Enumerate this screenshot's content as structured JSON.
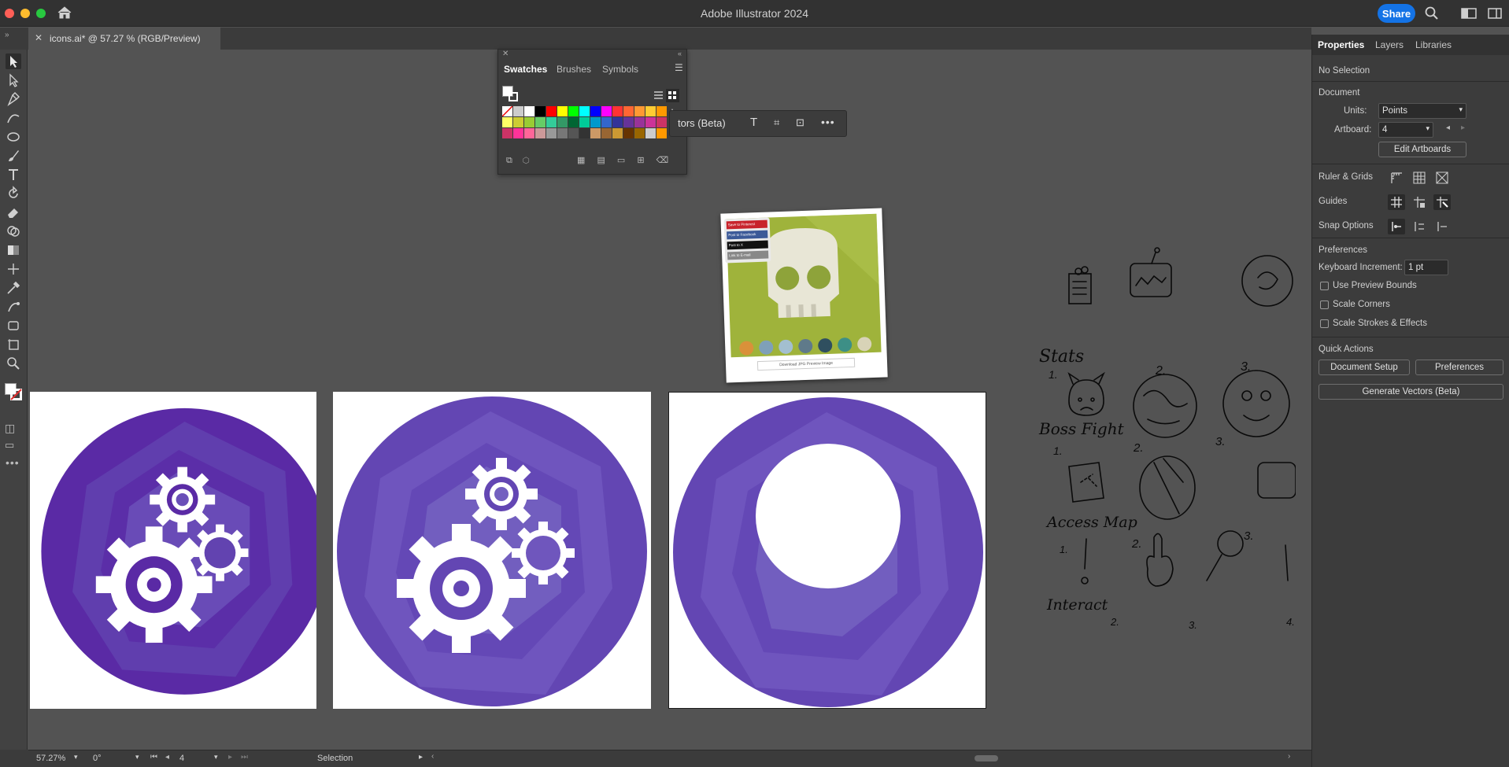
{
  "app": {
    "title": "Adobe Illustrator 2024",
    "share_label": "Share"
  },
  "document_tab": {
    "title": "icons.ai* @ 57.27 % (RGB/Preview)"
  },
  "swatches_panel": {
    "tabs": [
      "Swatches",
      "Brushes",
      "Symbols"
    ]
  },
  "context_bar": {
    "label": "tors (Beta)"
  },
  "preview_card": {
    "badges": [
      "Save to Pinterest",
      "Post to Facebook",
      "Post to X",
      "Link to E-mail"
    ],
    "footer": "Download JPG Preview Image"
  },
  "sketch_notes": {
    "stats": "Stats",
    "boss_fight": "Boss Fight",
    "access_map": "Access Map",
    "interact": "Interact",
    "nums": [
      "1.",
      "2.",
      "3.",
      "4."
    ]
  },
  "properties_panel": {
    "tabs": [
      "Properties",
      "Layers",
      "Libraries"
    ],
    "selection": "No Selection",
    "document_heading": "Document",
    "units_label": "Units:",
    "units_value": "Points",
    "artboard_label": "Artboard:",
    "artboard_value": "4",
    "edit_artboards": "Edit Artboards",
    "ruler_grids": "Ruler & Grids",
    "guides": "Guides",
    "snap_options": "Snap Options",
    "preferences_heading": "Preferences",
    "keyboard_increment_label": "Keyboard Increment:",
    "keyboard_increment_value": "1 pt",
    "checkboxes": [
      "Use Preview Bounds",
      "Scale Corners",
      "Scale Strokes & Effects"
    ],
    "quick_actions": "Quick Actions",
    "document_setup": "Document Setup",
    "preferences_button": "Preferences",
    "generate_vectors": "Generate Vectors (Beta)"
  },
  "status_bar": {
    "zoom": "57.27%",
    "rotation": "0°",
    "artboard": "4",
    "mode": "Selection"
  },
  "colors": {
    "accent": "#1473e6",
    "purple_dark": "#5a2aa5",
    "purple_light": "#6f5bbd"
  }
}
